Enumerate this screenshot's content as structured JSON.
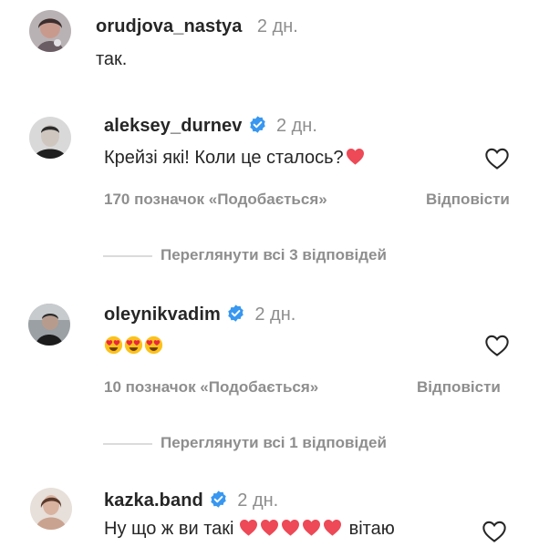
{
  "comments": [
    {
      "username": "orudjova_nastya",
      "time": "2 дн.",
      "text": "так.",
      "verified": false
    },
    {
      "username": "aleksey_durnev",
      "time": "2 дн.",
      "text": "Крейзі які! Коли це сталось?",
      "text_emoji": "red-heart",
      "verified": true,
      "likes": "170 позначок «Подобається»",
      "reply": "Відповісти",
      "view_replies": "Переглянути всі 3 відповідей"
    },
    {
      "username": "oleynikvadim",
      "time": "2 дн.",
      "emoji": [
        "smiling-face-with-heart-eyes",
        "smiling-face-with-heart-eyes",
        "smiling-face-with-heart-eyes"
      ],
      "verified": true,
      "likes": "10 позначок «Подобається»",
      "reply": "Відповісти",
      "view_replies": "Переглянути всі 1 відповідей"
    },
    {
      "username": "kazka.band",
      "time": "2 дн.",
      "text_before": "Ну що ж ви такі",
      "hearts_count": 5,
      "text_after": "вітаю",
      "verified": true
    }
  ],
  "colors": {
    "username": "#262626",
    "secondary": "#8e8e8e",
    "verified_badge": "#3897f0",
    "heart_emoji": "#ed4956"
  },
  "icons": {
    "like": "heart-outline-icon",
    "verified": "verified-badge-icon"
  }
}
